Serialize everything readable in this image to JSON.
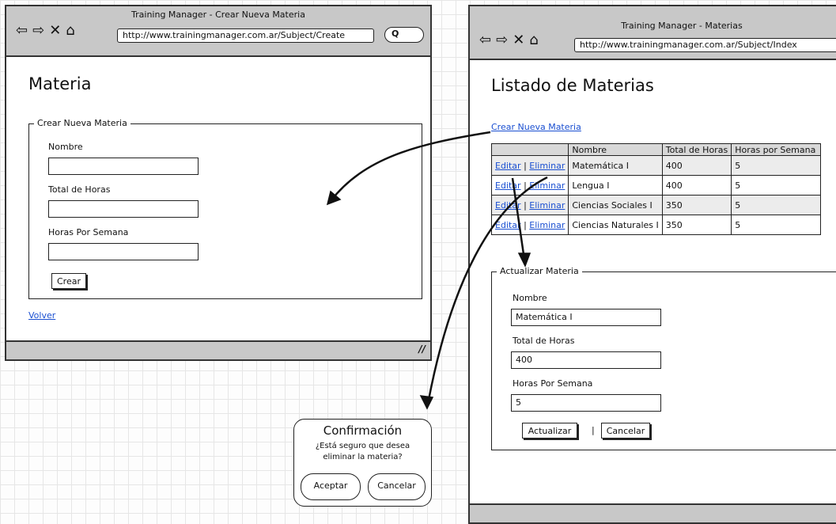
{
  "create_window": {
    "title": "Training Manager - Crear Nueva Materia",
    "url": "http://www.trainingmanager.com.ar/Subject/Create",
    "search_placeholder": "Q",
    "heading": "Materia",
    "fieldset_legend": "Crear Nueva Materia",
    "fields": [
      {
        "label": "Nombre",
        "value": ""
      },
      {
        "label": "Total de Horas",
        "value": ""
      },
      {
        "label": "Horas Por Semana",
        "value": ""
      }
    ],
    "create_button": "Crear",
    "back_link": "Volver",
    "resize_grip": "//"
  },
  "index_window": {
    "title": "Training Manager - Materias",
    "url": "http://www.trainingmanager.com.ar/Subject/Index",
    "heading": "Listado de Materias",
    "new_link": "Crear Nueva Materia",
    "table": {
      "columns": [
        "",
        "Nombre",
        "Total de Horas",
        "Horas por Semana"
      ],
      "edit_label": "Editar",
      "separator": "|",
      "delete_label": "Eliminar",
      "rows": [
        {
          "nombre": "Matemática I",
          "total": "400",
          "semana": "5"
        },
        {
          "nombre": "Lengua I",
          "total": "400",
          "semana": "5"
        },
        {
          "nombre": "Ciencias Sociales I",
          "total": "350",
          "semana": "5"
        },
        {
          "nombre": "Ciencias Naturales I",
          "total": "350",
          "semana": "5"
        }
      ]
    },
    "update_legend": "Actualizar Materia",
    "update_fields": [
      {
        "label": "Nombre",
        "value": "Matemática I"
      },
      {
        "label": "Total de Horas",
        "value": "400"
      },
      {
        "label": "Horas Por Semana",
        "value": "5"
      }
    ],
    "update_button": "Actualizar",
    "button_separator": "|",
    "cancel_button": "Cancelar"
  },
  "confirm_dialog": {
    "title": "Confirmación",
    "message_line1": "¿Está seguro que desea",
    "message_line2": "eliminar la materia?",
    "accept": "Aceptar",
    "cancel": "Cancelar"
  },
  "nav_icons": [
    "back-arrow-icon",
    "forward-arrow-icon",
    "stop-icon",
    "home-icon"
  ],
  "nav_glyphs": {
    "back": "⇦",
    "forward": "⇨",
    "stop": "✕",
    "home": "⌂"
  },
  "colors": {
    "link": "#1a4fd1",
    "chrome": "#c8c8c8",
    "header_cell": "#d8d8d8",
    "alt_row": "#ececec"
  }
}
